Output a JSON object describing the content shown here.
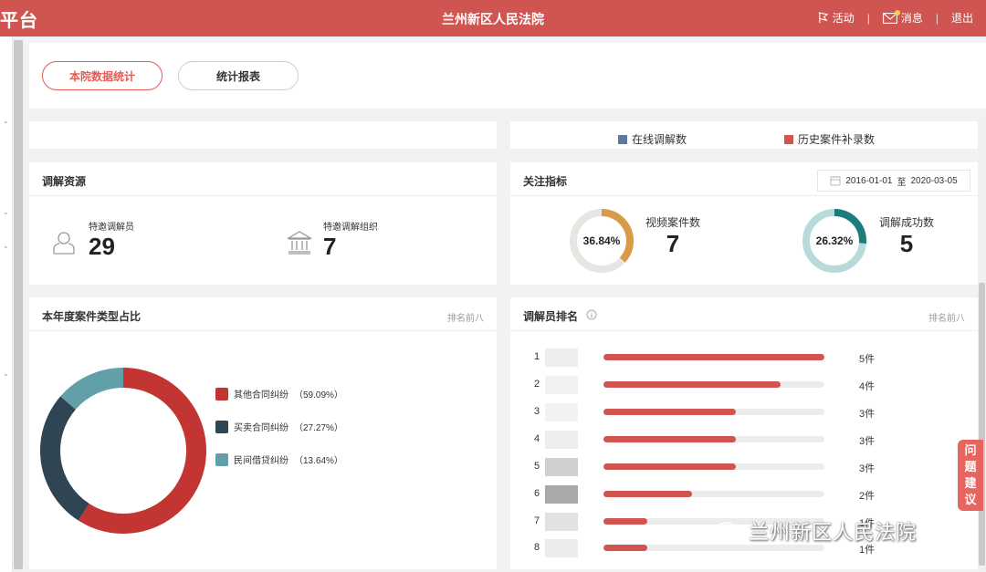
{
  "header": {
    "brand": "平台",
    "court_name": "兰州新区人民法院",
    "activity_label": "活动",
    "message_label": "消息",
    "logout_label": "退出",
    "separator": "|"
  },
  "tabs": [
    {
      "label": "本院数据统计",
      "active": true
    },
    {
      "label": "统计报表",
      "active": false
    }
  ],
  "legend_top": {
    "online": "在线调解数",
    "history": "历史案件补录数"
  },
  "resources": {
    "title": "调解资源",
    "items": [
      {
        "label": "特邀调解员",
        "value": "29",
        "icon": "person-icon"
      },
      {
        "label": "特邀调解组织",
        "value": "7",
        "icon": "institution-icon"
      }
    ]
  },
  "indicators": {
    "title": "关注指标",
    "date_from": "2016-01-01",
    "date_sep": "至",
    "date_to": "2020-03-05",
    "items": [
      {
        "pct_label": "36.84%",
        "pct": 36.84,
        "label": "视频案件数",
        "value": "7",
        "color": "#d99a4a",
        "track": "#e8e6e3"
      },
      {
        "pct_label": "26.32%",
        "pct": 26.32,
        "label": "调解成功数",
        "value": "5",
        "color": "#1a7c7b",
        "track": "#b9dada"
      }
    ]
  },
  "case_types": {
    "title": "本年度案件类型占比",
    "subtitle": "排名前八",
    "chart_data": {
      "type": "pie",
      "labels": [
        "其他合同纠纷",
        "买卖合同纠纷",
        "民间借贷纠纷"
      ],
      "values": [
        59.09,
        27.27,
        13.64
      ],
      "display": [
        "（59.09%）",
        "（27.27%）",
        "（13.64%）"
      ],
      "colors": [
        "#c33532",
        "#2f4554",
        "#61a0a8"
      ]
    }
  },
  "ranking": {
    "title": "调解员排名",
    "subtitle": "排名前八",
    "chart_data": {
      "type": "bar",
      "categories": [
        "1",
        "2",
        "3",
        "4",
        "5",
        "6",
        "7",
        "8"
      ],
      "values": [
        5,
        4,
        3,
        3,
        3,
        2,
        1,
        1
      ],
      "value_labels": [
        "5件",
        "4件",
        "3件",
        "3件",
        "3件",
        "2件",
        "1件",
        "1件"
      ],
      "max": 5
    }
  },
  "feedback": {
    "chars": [
      "问",
      "题",
      "建",
      "议"
    ]
  },
  "watermark": "兰州新区人民法院",
  "colors": {
    "accent": "#d05551",
    "online": "#5b7a9c",
    "history": "#d05551"
  }
}
